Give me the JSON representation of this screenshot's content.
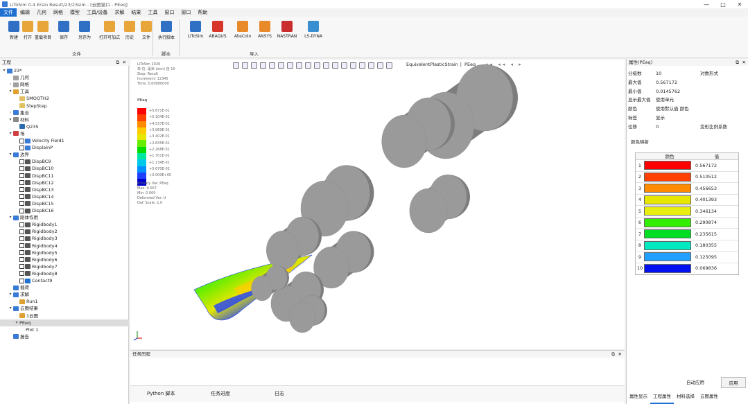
{
  "window": {
    "title": "LiToSim 0.4 Ersin Result/23/23sim - [云图窗口 - PEeq]",
    "controls": [
      "—",
      "□",
      "✕"
    ]
  },
  "menu": [
    "文件",
    "编辑",
    "几何",
    "网格",
    "模型",
    "工具/设备",
    "求解",
    "结果",
    "工具",
    "窗口",
    "窗口",
    "帮助"
  ],
  "ribbon": {
    "file_group": "文件",
    "file_buttons": [
      "新建",
      "打开",
      "重载项目",
      "保存",
      "另存为",
      "打开可加式",
      "历史",
      "文件"
    ],
    "script_group": "脚本",
    "script_buttons": [
      "执行脚本"
    ],
    "import_group": "导入",
    "import_buttons": [
      "LiToSim",
      "ABAQUS",
      "AbsColo",
      "ANSYS",
      "NASTRAN",
      "LS-DYNA"
    ],
    "colors": {
      "file_icon": "#e8a53a",
      "blue_icon": "#2f6fc4",
      "import_icon": "#2f6fc4",
      "abaqus": "#d9362b",
      "ansys": "#e88a2a",
      "nastran": "#c92d2d",
      "lsdyna": "#3a8fd0"
    }
  },
  "left_panel": {
    "title": "工程",
    "tree": [
      {
        "indent": 0,
        "toggle": "▾",
        "icon": "#3a7bd5",
        "label": "23*"
      },
      {
        "indent": 1,
        "toggle": "",
        "icon": "#a0a0a0",
        "label": "几何"
      },
      {
        "indent": 1,
        "toggle": "›",
        "icon": "#a0a0a0",
        "label": "网格"
      },
      {
        "indent": 1,
        "toggle": "▾",
        "icon": "#e0a030",
        "label": "工具"
      },
      {
        "indent": 2,
        "toggle": "",
        "icon": "#e0c060",
        "label": "SMOOTH2"
      },
      {
        "indent": 2,
        "toggle": "",
        "icon": "#e0c060",
        "label": "StepStep"
      },
      {
        "indent": 1,
        "toggle": "›",
        "icon": "#3a7bd5",
        "label": "集合"
      },
      {
        "indent": 1,
        "toggle": "▾",
        "icon": "#888",
        "label": "材料"
      },
      {
        "indent": 2,
        "toggle": "",
        "icon": "#2b6cb0",
        "label": "Q235"
      },
      {
        "indent": 1,
        "toggle": "▾",
        "icon": "#d04040",
        "label": "场"
      },
      {
        "indent": 2,
        "check": true,
        "icon": "#3a7bd5",
        "label": "Velocity Field1"
      },
      {
        "indent": 2,
        "check": true,
        "icon": "#3a7bd5",
        "label": "DisplaInP"
      },
      {
        "indent": 1,
        "toggle": "▾",
        "icon": "#3a7bd5",
        "label": "边界"
      },
      {
        "indent": 2,
        "check": true,
        "icon": "#555",
        "label": "DispBC9"
      },
      {
        "indent": 2,
        "check": true,
        "icon": "#555",
        "label": "DispBC10"
      },
      {
        "indent": 2,
        "check": true,
        "icon": "#555",
        "label": "DispBC11"
      },
      {
        "indent": 2,
        "check": true,
        "icon": "#555",
        "label": "DispBC12"
      },
      {
        "indent": 2,
        "check": true,
        "icon": "#555",
        "label": "DispBC13"
      },
      {
        "indent": 2,
        "check": true,
        "icon": "#555",
        "label": "DispBC14"
      },
      {
        "indent": 2,
        "check": true,
        "icon": "#555",
        "label": "DispBC15"
      },
      {
        "indent": 2,
        "check": true,
        "icon": "#555",
        "label": "DispBC16"
      },
      {
        "indent": 1,
        "toggle": "▾",
        "icon": "#3a7bd5",
        "label": "刚体作用"
      },
      {
        "indent": 2,
        "check": true,
        "icon": "#555",
        "label": "Rigidbody1"
      },
      {
        "indent": 2,
        "check": true,
        "icon": "#555",
        "label": "Rigidbody2"
      },
      {
        "indent": 2,
        "check": true,
        "icon": "#555",
        "label": "Rigidbody3"
      },
      {
        "indent": 2,
        "check": true,
        "icon": "#555",
        "label": "Rigidbody4"
      },
      {
        "indent": 2,
        "check": true,
        "icon": "#555",
        "label": "Rigidbody5"
      },
      {
        "indent": 2,
        "check": true,
        "icon": "#555",
        "label": "Rigidbody6"
      },
      {
        "indent": 2,
        "check": true,
        "icon": "#555",
        "label": "Rigidbody7"
      },
      {
        "indent": 2,
        "check": true,
        "icon": "#555",
        "label": "Rigidbody8"
      },
      {
        "indent": 2,
        "check": true,
        "icon": "#1e6fd0",
        "label": "Contact9"
      },
      {
        "indent": 1,
        "toggle": "",
        "icon": "#3a7bd5",
        "label": "载荷"
      },
      {
        "indent": 1,
        "toggle": "▾",
        "icon": "#3a7bd5",
        "label": "求解"
      },
      {
        "indent": 2,
        "toggle": "",
        "icon": "#e0a030",
        "label": "Run1"
      },
      {
        "indent": 1,
        "toggle": "▾",
        "icon": "#3a7bd5",
        "label": "云图结果"
      },
      {
        "indent": 2,
        "toggle": "",
        "icon": "#e0a030",
        "label": "1云图"
      },
      {
        "indent": 2,
        "toggle": "▾",
        "icon": "",
        "label": "PEeq",
        "selected": true
      },
      {
        "indent": 3,
        "toggle": "",
        "icon": "",
        "label": "Plot 1"
      },
      {
        "indent": 1,
        "toggle": "",
        "icon": "#3a7bd5",
        "label": "报告"
      }
    ]
  },
  "viewport": {
    "toolbar_field": "EquivalentPlasticStrain",
    "toolbar_field2": "PEeq",
    "info_lines": [
      "LiToSim 2026",
      "单 位: 毫米 (mm) 自 10",
      "Step: Result",
      "Increment: 12345",
      "Time: 0.00000000"
    ],
    "legend_title": "PEeq",
    "legend_colors": [
      "#ff0000",
      "#ff4000",
      "#ff8c00",
      "#ffcc00",
      "#e6e600",
      "#66ee00",
      "#00dd00",
      "#00e8a0",
      "#00c8e8",
      "#0090ff",
      "#2040ff",
      "#0000cc"
    ],
    "legend_values": [
      "+5.671E-01",
      "+5.104E-01",
      "+4.537E-01",
      "+3.969E-01",
      "+3.402E-01",
      "+2.835E-01",
      "+2.268E-01",
      "+1.701E-01",
      "+1.134E-01",
      "+5.670E-02",
      "+0.000E+00"
    ],
    "info_lines2": [
      "Primary Var: PEeq",
      "Max: 0.567",
      "Min: 0.000",
      "Deformed Var: U",
      "Def. Scale: 1.0"
    ],
    "roll_color": "#9a9a9a",
    "roll_shade": "#7d7d7d"
  },
  "bottom_panel": {
    "title": "任务历程",
    "tabs": [
      "Python 脚本",
      "任务进度",
      "日志"
    ]
  },
  "right_panel": {
    "title": "属性(PEeq)",
    "rows": [
      {
        "k": "分级数",
        "v": "10",
        "extra": "对数形式"
      },
      {
        "k": "最大值",
        "v": "0.567172"
      },
      {
        "k": "最小值",
        "v": "0.0145762"
      },
      {
        "k": "显示最大值",
        "v": "使用单元"
      },
      {
        "k": "颜色",
        "v": "使用默认值 颜色"
      },
      {
        "k": "标签",
        "v": "显示"
      },
      {
        "k": "位移",
        "v": "0",
        "extra": "变形比例系数"
      }
    ],
    "table_title": "颜色映射",
    "table_headers": [
      "颜色",
      "值"
    ],
    "color_rows": [
      {
        "n": "1",
        "color": "#ff0000",
        "value": "0.567172"
      },
      {
        "n": "2",
        "color": "#ff4000",
        "value": "0.510512"
      },
      {
        "n": "3",
        "color": "#ff8c00",
        "value": "0.456653"
      },
      {
        "n": "4",
        "color": "#e6e600",
        "value": "0.401393"
      },
      {
        "n": "5",
        "color": "#e8ee10",
        "value": "0.346134"
      },
      {
        "n": "6",
        "color": "#33ee00",
        "value": "0.290874"
      },
      {
        "n": "7",
        "color": "#00dd22",
        "value": "0.235615"
      },
      {
        "n": "8",
        "color": "#00e8c0",
        "value": "0.180355"
      },
      {
        "n": "9",
        "color": "#22a0ff",
        "value": "0.125095"
      },
      {
        "n": "10",
        "color": "#0010ee",
        "value": "0.069836"
      }
    ],
    "apply_label": "应用",
    "apply_label2": "自动应用",
    "tabs": [
      "属性显示",
      "工程属性",
      "材料选择",
      "云图属性"
    ]
  }
}
